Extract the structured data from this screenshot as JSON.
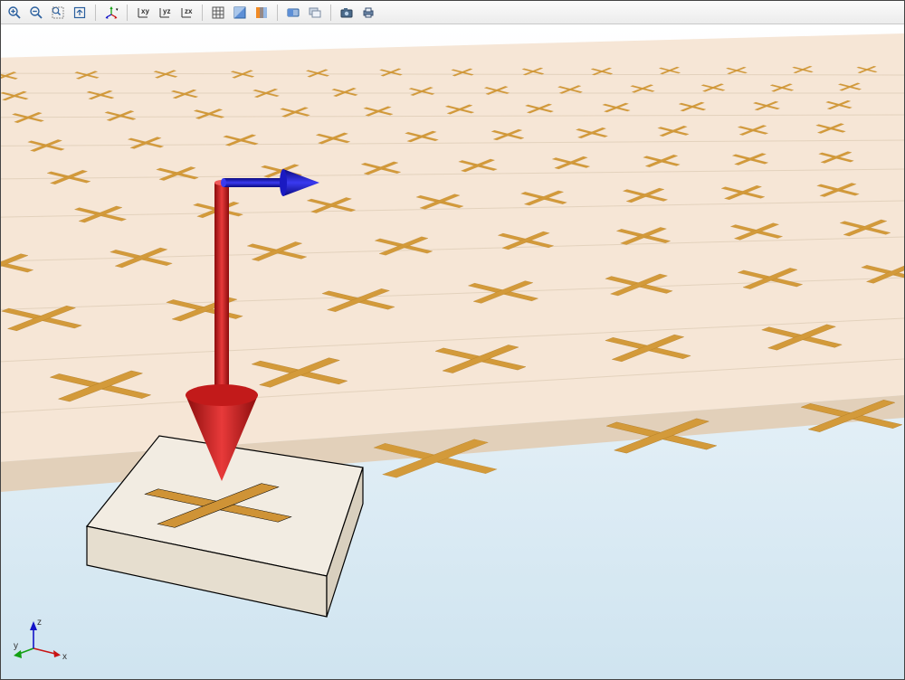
{
  "toolbar": {
    "zoom_in": "zoom-in",
    "zoom_out": "zoom-out",
    "zoom_box": "zoom-box",
    "zoom_extents": "zoom-extents",
    "rotate": "rotate",
    "view_xy": "xy",
    "view_yz": "yz",
    "view_zx": "zx",
    "grid": "grid",
    "scene_light": "scene-light",
    "transparency": "transparency",
    "clip": "clip",
    "show_hide": "show-hide",
    "snapshot": "snapshot",
    "print": "print"
  },
  "scene": {
    "background_top": "#ffffff",
    "background_bottom": "#cfe4f0",
    "substrate_color": "#f6e6d6",
    "substrate_side": "#e9dccb",
    "cross_color": "#d39a3a",
    "cross_stroke": "#b07c26",
    "unit_cell_face": "#f2ece2",
    "unit_cell_side": "#e2dacd",
    "unit_cell_edge": "#000000",
    "arrows": {
      "k_vector_color": "#d21919",
      "h_field_color": "#1414c8"
    }
  },
  "triad": {
    "x_label": "x",
    "y_label": "y",
    "z_label": "z",
    "x_color": "#c81414",
    "y_color": "#14a014",
    "z_color": "#1414c8"
  }
}
